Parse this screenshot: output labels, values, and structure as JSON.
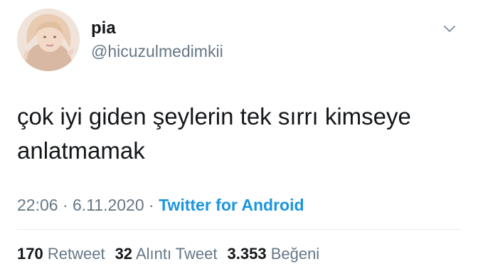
{
  "user": {
    "display_name": "pia",
    "handle": "@hicuzulmedimkii",
    "avatar_icon": "profile-photo"
  },
  "tweet": {
    "text_line1": "çok iyi giden şeylerin tek sırrı kimseye",
    "text_line2": "anlatmamak",
    "time": "22:06",
    "separator": "·",
    "date": "6.11.2020",
    "source": "Twitter for Android"
  },
  "stats": {
    "retweets_count": "170",
    "retweets_label": "Retweet",
    "quotes_count": "32",
    "quotes_label": "Alıntı Tweet",
    "likes_count": "3.353",
    "likes_label": "Beğeni"
  },
  "menu": {
    "icon": "chevron-down-icon"
  },
  "colors": {
    "text": "#14171a",
    "secondary": "#657786",
    "accent": "#1b95e0",
    "divider": "#e6ecf0"
  }
}
